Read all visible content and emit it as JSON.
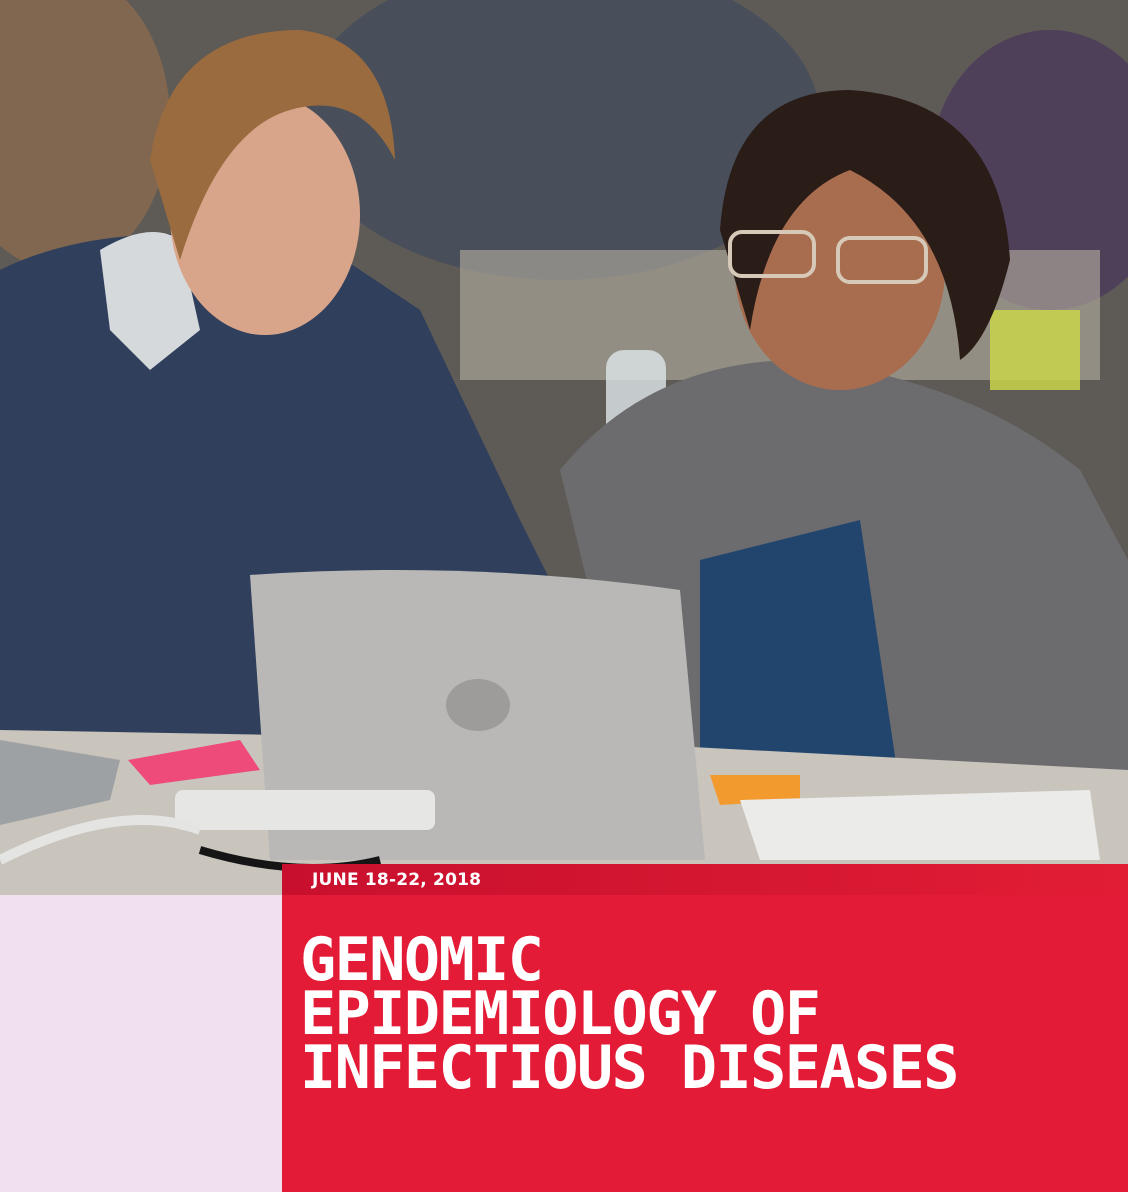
{
  "event": {
    "date": "JUNE 18-22, 2018",
    "title_lines": [
      "GENOMIC",
      "EPIDEMIOLOGY OF",
      "INFECTIOUS DISEASES"
    ]
  },
  "colors": {
    "accent_red": "#e31b36",
    "strip_red": "#c8102e",
    "side_panel_pink": "#f1e1ee",
    "title_text": "#ffffff"
  }
}
